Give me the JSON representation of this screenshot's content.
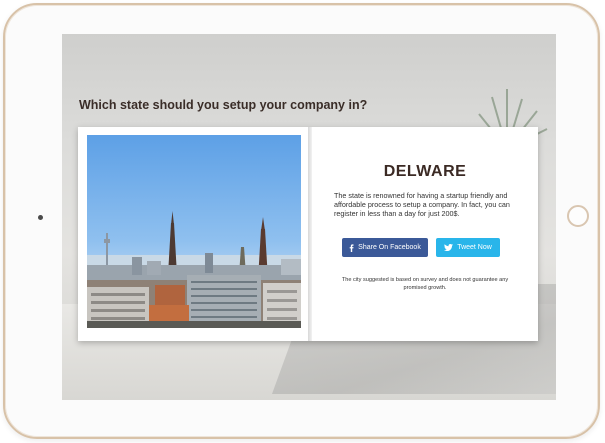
{
  "page": {
    "heading": "Which state should you setup your company in?"
  },
  "result": {
    "state": "DELWARE",
    "description": "The state is renowned for having a startup friendly and affordable process to setup a company. In fact, you can register in less than a day for just 200$.",
    "disclaimer": "The city suggested is based on survey and does not guarantee any promised growth."
  },
  "share": {
    "facebook_label": "Share On Facebook",
    "twitter_label": "Tweet Now"
  },
  "icons": {
    "facebook": "facebook-icon",
    "twitter": "twitter-icon"
  },
  "colors": {
    "facebook": "#3b5998",
    "twitter": "#29b5ea",
    "heading_text": "#3a2d28",
    "device_frame": "#d8c2a8"
  }
}
